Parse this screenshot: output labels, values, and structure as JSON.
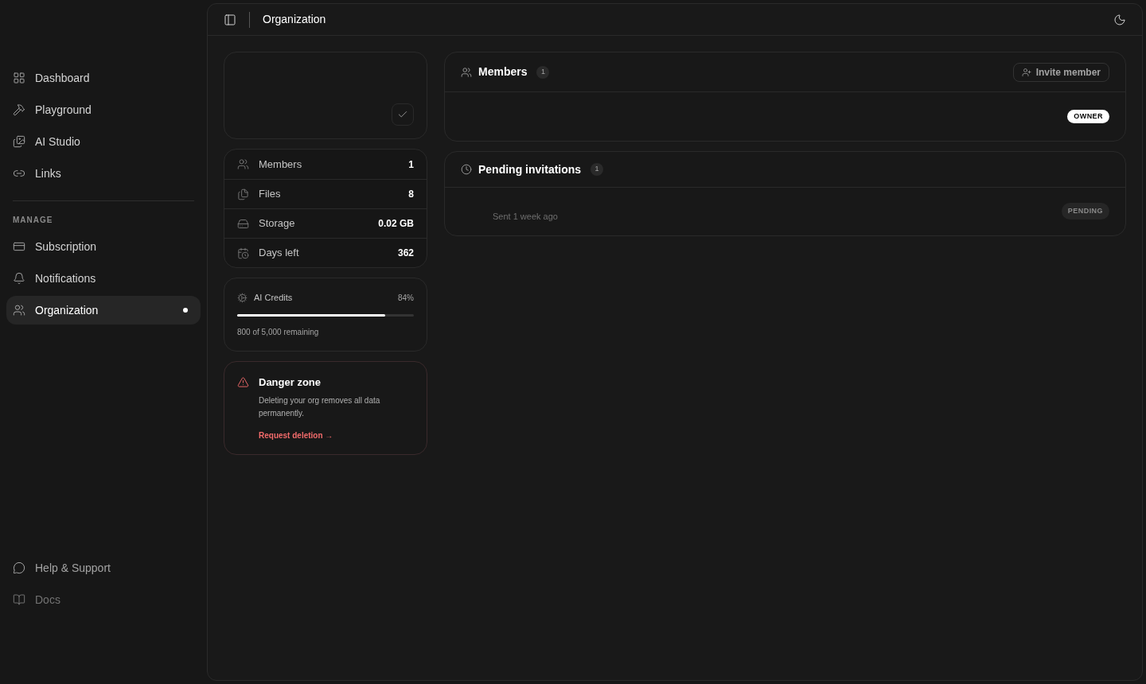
{
  "sidebar": {
    "items": [
      {
        "label": "Dashboard",
        "kind": "grid",
        "selected": false
      },
      {
        "label": "Playground",
        "kind": "hammer",
        "selected": false
      },
      {
        "label": "AI Studio",
        "kind": "images",
        "selected": false
      },
      {
        "label": "Links",
        "kind": "link",
        "selected": false
      }
    ],
    "section_title": "MANAGE",
    "manage_items": [
      {
        "label": "Subscription",
        "kind": "card",
        "selected": false
      },
      {
        "label": "Notifications",
        "kind": "bell",
        "selected": false
      },
      {
        "label": "Organization",
        "kind": "users",
        "selected": true
      }
    ],
    "footer_items": [
      {
        "label": "Help & Support",
        "kind": "chat"
      },
      {
        "label": "Docs",
        "kind": "book"
      }
    ]
  },
  "header": {
    "title": "Organization"
  },
  "stats": [
    {
      "label": "Members",
      "value": "1",
      "kind": "users"
    },
    {
      "label": "Files",
      "value": "8",
      "kind": "files"
    },
    {
      "label": "Storage",
      "value": "0.02 GB",
      "kind": "drive"
    },
    {
      "label": "Days left",
      "value": "362",
      "kind": "calendar"
    }
  ],
  "credits": {
    "label": "AI Credits",
    "percent": "84%",
    "level": 0.84,
    "remaining": "800 of 5,000 remaining"
  },
  "danger": {
    "title": "Danger zone",
    "text": "Deleting your org removes all data permanently.",
    "link": "Request deletion →"
  },
  "members": {
    "title": "Members",
    "count": "1",
    "invite": "Invite member",
    "role": "OWNER"
  },
  "invitations": {
    "title": "Pending invitations",
    "count": "1",
    "sent": "Sent 1 week ago",
    "status": "PENDING"
  }
}
